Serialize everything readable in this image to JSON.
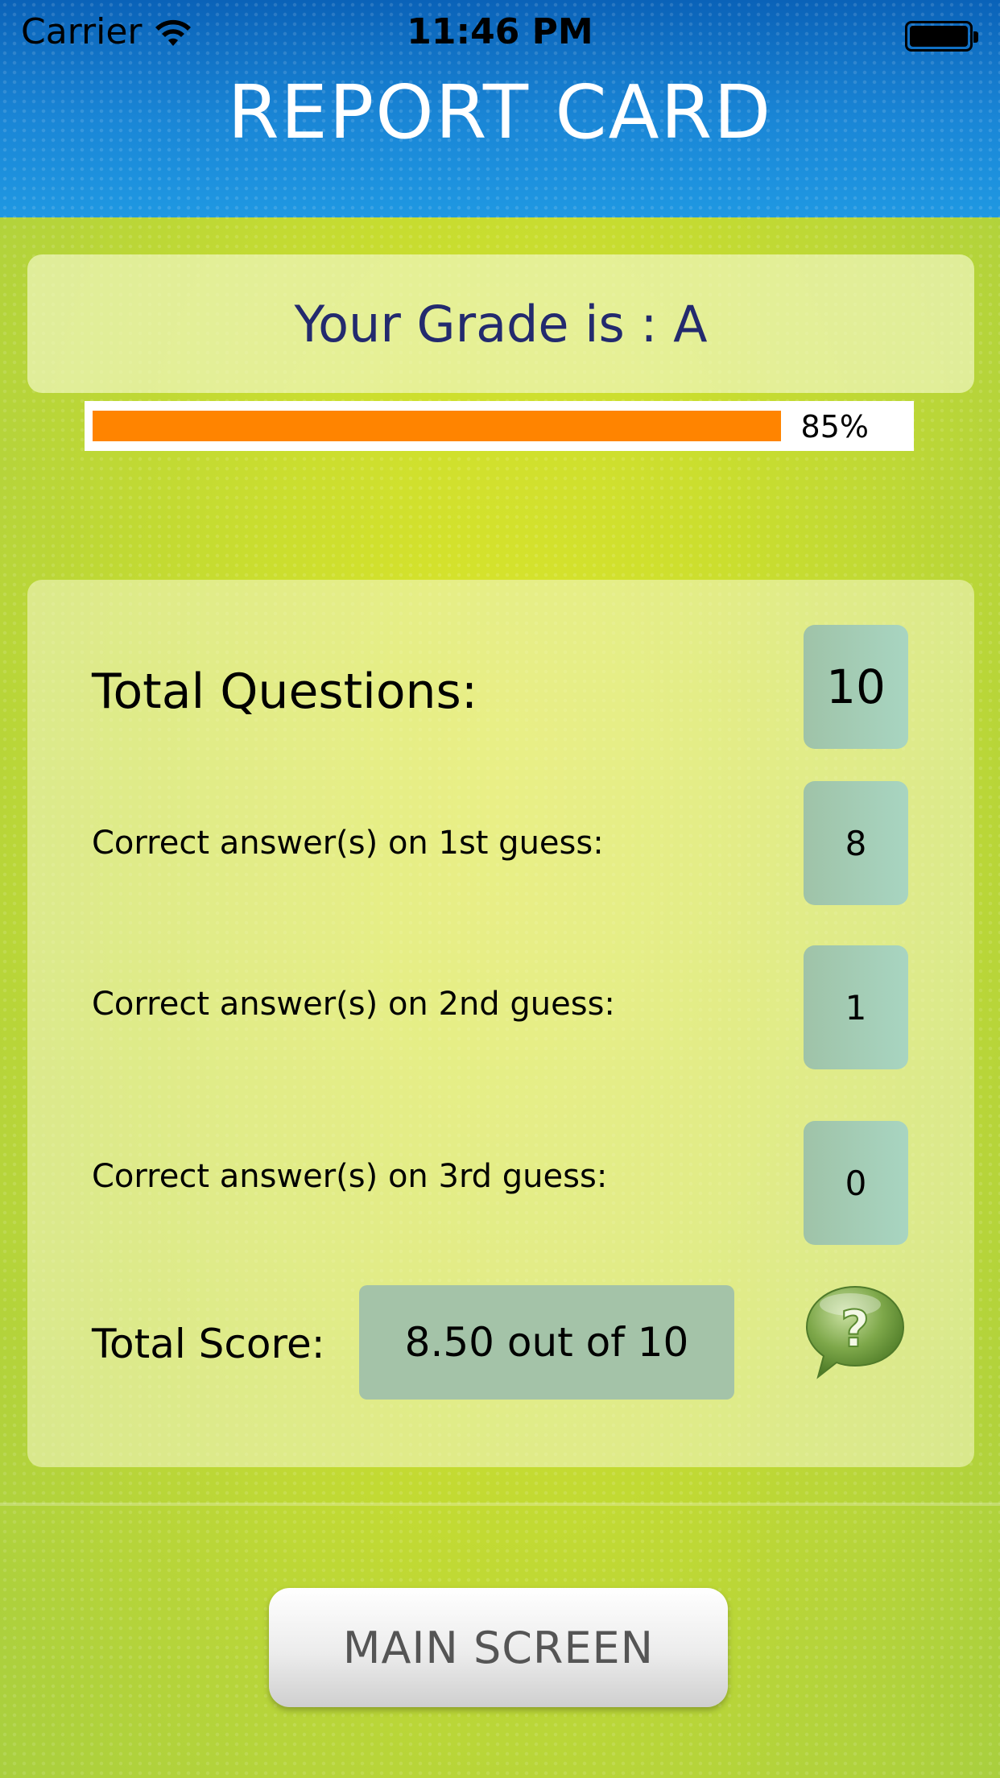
{
  "status_bar": {
    "carrier": "Carrier",
    "time": "11:46 PM"
  },
  "header": {
    "title": "REPORT CARD"
  },
  "grade": {
    "text": "Your Grade is : A"
  },
  "progress": {
    "percent": 85,
    "label": "85%",
    "color": "#ff8400"
  },
  "stats": {
    "total_questions_label": "Total Questions:",
    "total_questions_value": "10",
    "first_guess_label": "Correct answer(s) on 1st guess:",
    "first_guess_value": "8",
    "second_guess_label": "Correct answer(s) on 2nd guess:",
    "second_guess_value": "1",
    "third_guess_label": "Correct answer(s) on 3rd guess:",
    "third_guess_value": "0",
    "total_score_label": "Total Score:",
    "total_score_value": "8.50 out of 10",
    "help_icon": "question-bubble-icon"
  },
  "footer": {
    "main_button_label": "MAIN SCREEN"
  },
  "colors": {
    "header_blue": "#1a86d6",
    "background_green": "#c9dd2f",
    "grade_text": "#232a6e"
  }
}
